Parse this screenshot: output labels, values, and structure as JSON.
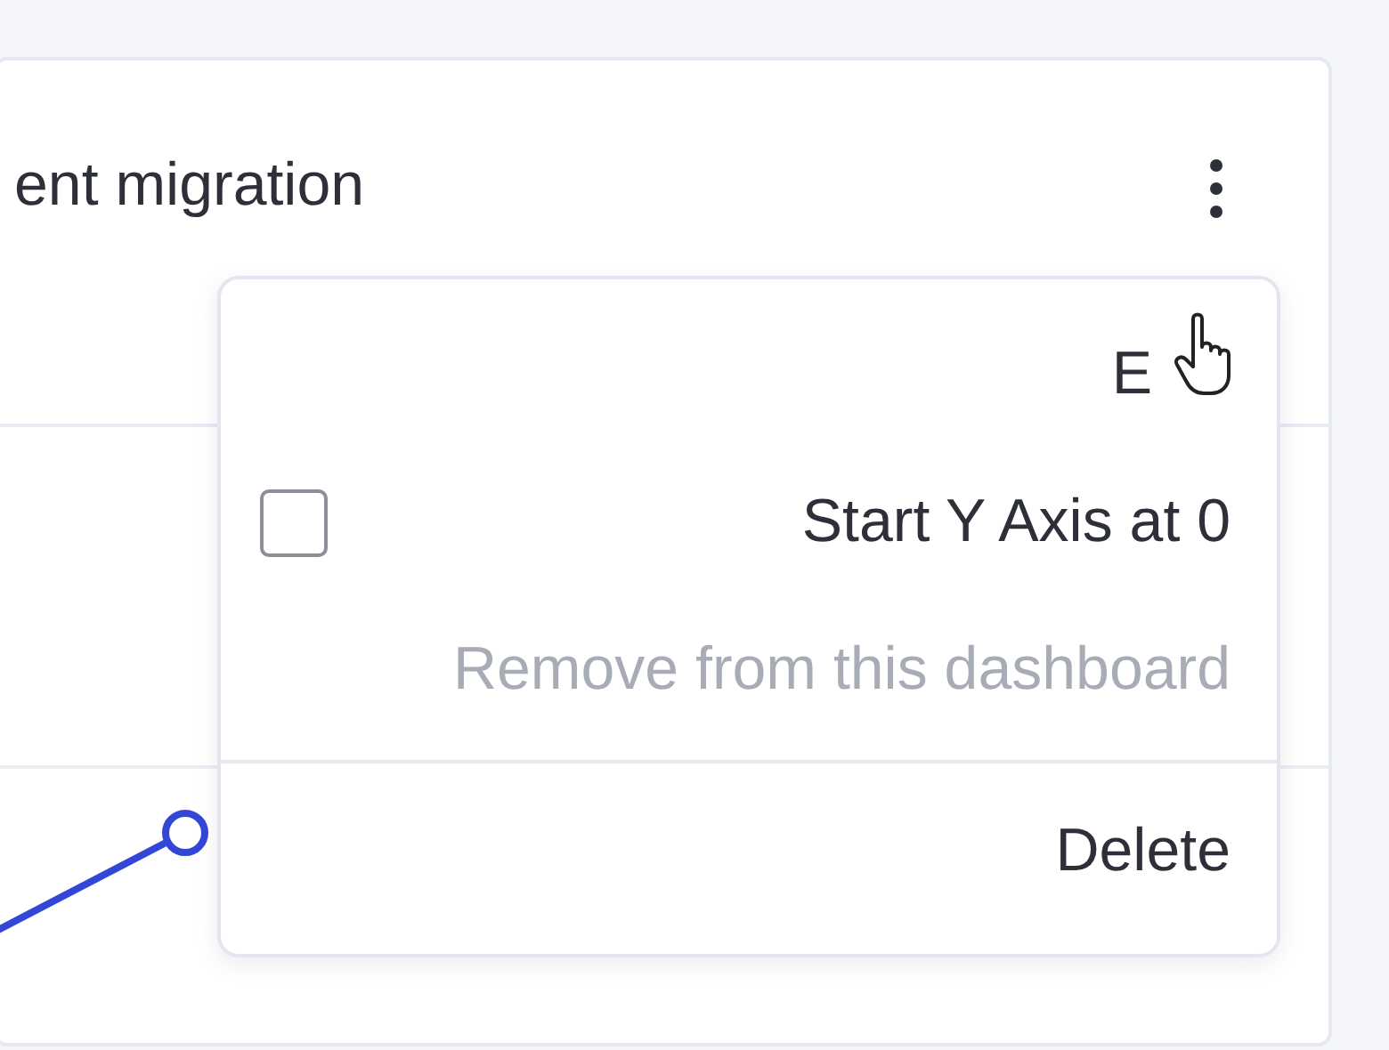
{
  "card": {
    "title": "ent migration"
  },
  "menu": {
    "items": [
      {
        "kind": "action",
        "label": "E",
        "disabled": false
      },
      {
        "kind": "checkbox",
        "label": "Start Y Axis at 0",
        "checked": false
      },
      {
        "kind": "action",
        "label": "Remove from this dashboard",
        "disabled": true
      },
      {
        "kind": "divider"
      },
      {
        "kind": "action",
        "label": "Delete",
        "disabled": false
      }
    ]
  }
}
